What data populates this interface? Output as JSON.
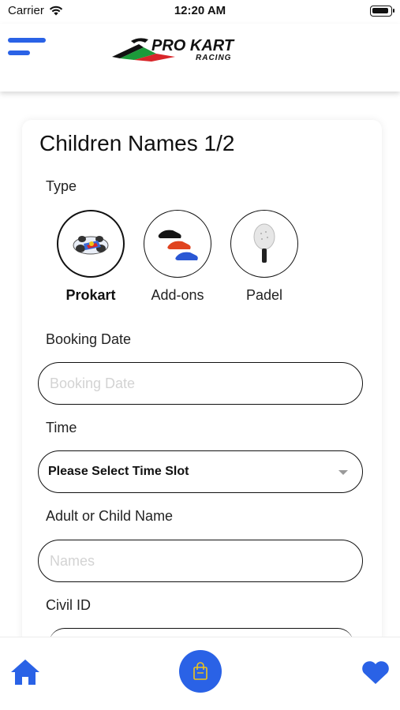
{
  "status": {
    "carrier": "Carrier",
    "time": "12:20 AM"
  },
  "header": {
    "logo_text_main": "PRO KART",
    "logo_text_sub": "RACING",
    "brand_color": "#2a62e6"
  },
  "form": {
    "title": "Children Names 1/2",
    "type_label": "Type",
    "types": [
      {
        "label": "Prokart",
        "selected": true,
        "icon": "kart-image"
      },
      {
        "label": "Add-ons",
        "selected": false,
        "icon": "shoes-image"
      },
      {
        "label": "Padel",
        "selected": false,
        "icon": "padel-racket-image"
      }
    ],
    "booking_date_label": "Booking Date",
    "booking_date_placeholder": "Booking Date",
    "booking_date_value": "",
    "time_label": "Time",
    "time_value": "Please Select Time Slot",
    "name_label": "Adult or Child Name",
    "name_placeholder": "Names",
    "name_value": "",
    "civil_id_label": "Civil ID"
  },
  "tabbar": {
    "home_icon": "home-icon",
    "cart_icon": "shopping-bag-icon",
    "favorites_icon": "heart-icon",
    "accent": "#2a62e6"
  }
}
